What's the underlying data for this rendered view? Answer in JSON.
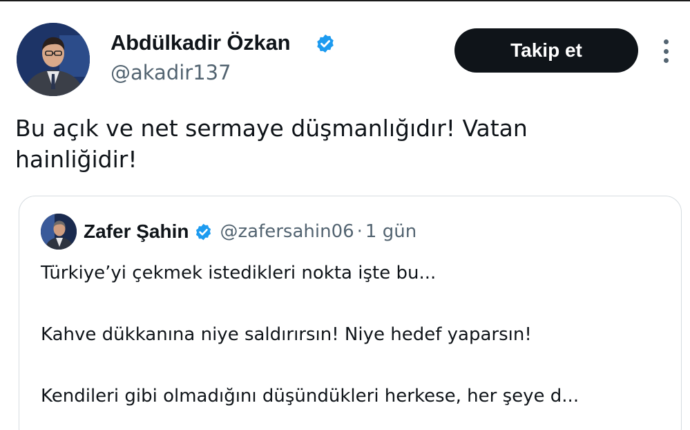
{
  "tweet": {
    "author": {
      "name": "Abdülkadir Özkan",
      "handle": "@akadir137",
      "avatar": "avatar-photo",
      "verified": true
    },
    "follow_label": "Takip et",
    "more_icon": "more-vertical-icon",
    "text": "Bu açık ve net sermaye düşmanlığıdır! Vatan\nhainliğidir!"
  },
  "quote": {
    "author": {
      "name": "Zafer Şahin",
      "handle": "@zafersahin06",
      "avatar": "avatar-photo",
      "verified": true
    },
    "separator": "·",
    "time": "1 gün",
    "lines": [
      "Türkiye’yi çekmek istedikleri nokta işte bu...",
      "Kahve dükkanına niye saldırırsın! Niye hedef yaparsın!",
      "Kendileri gibi olmadığını düşündükleri herkese, her şeye d..."
    ]
  },
  "colors": {
    "verified_badge": "#1d9bf0",
    "text_primary": "#0f1419",
    "text_secondary": "#536471",
    "button_bg": "#0f1419",
    "card_border": "#d5dbe0"
  }
}
